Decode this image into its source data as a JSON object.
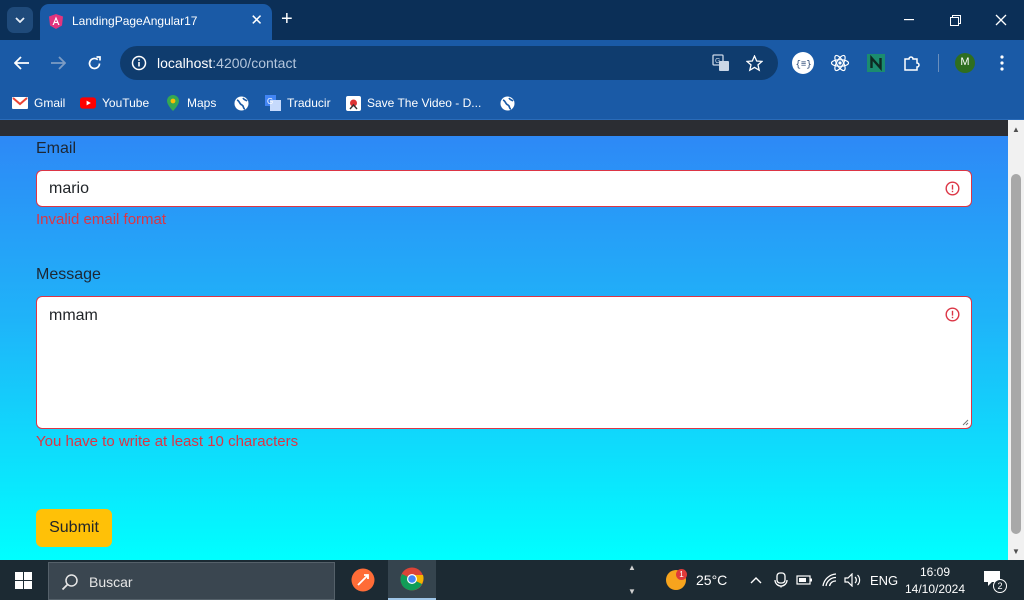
{
  "browser": {
    "tab": {
      "title": "LandingPageAngular17",
      "close": "✕"
    },
    "new_tab": "+",
    "address": {
      "host": "localhost",
      "path": ":4200/contact"
    },
    "bookmarks": [
      {
        "label": "Gmail",
        "icon": "gmail-icon"
      },
      {
        "label": "YouTube",
        "icon": "youtube-icon"
      },
      {
        "label": "Maps",
        "icon": "maps-icon"
      },
      {
        "label": "",
        "icon": "globe-icon"
      },
      {
        "label": "Traducir",
        "icon": "translate-icon"
      },
      {
        "label": "Save The Video - D...",
        "icon": "save-video-icon"
      },
      {
        "label": "",
        "icon": "globe-icon"
      }
    ],
    "profile_initial": "M",
    "colors": {
      "tab_active": "#1a5aa6",
      "titlebar": "#0b2f57",
      "omnibox": "#0f3c6e"
    }
  },
  "form": {
    "email": {
      "label": "Email",
      "value": "mario",
      "error": "Invalid email format"
    },
    "message": {
      "label": "Message",
      "value": "mmam",
      "error": "You have to write at least 10 characters"
    },
    "submit_label": "Submit",
    "colors": {
      "error": "#dc3545",
      "button": "#ffc107",
      "gradient_top": "#2f85f6",
      "gradient_bottom": "#00ffff"
    }
  },
  "taskbar": {
    "search_placeholder": "Buscar",
    "weather": {
      "temp": "25°C",
      "badge": "1"
    },
    "language": "ENG",
    "time": "16:09",
    "date": "14/10/2024",
    "notifications": "2"
  }
}
